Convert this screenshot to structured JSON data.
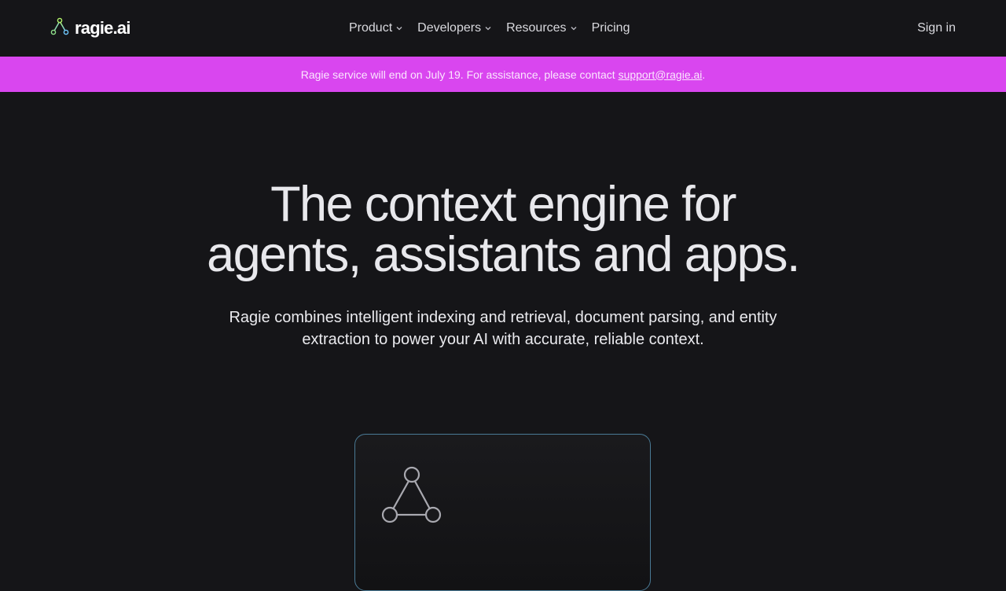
{
  "brand": {
    "name": "ragie.ai"
  },
  "nav": {
    "items": [
      {
        "label": "Product",
        "dropdown": true
      },
      {
        "label": "Developers",
        "dropdown": true
      },
      {
        "label": "Resources",
        "dropdown": true
      },
      {
        "label": "Pricing",
        "dropdown": false
      }
    ],
    "sign_in": "Sign in"
  },
  "banner": {
    "text": "Ragie service will end on July 19. For assistance, please contact ",
    "link": "support@ragie.ai",
    "suffix": "."
  },
  "hero": {
    "title_line1": "The context engine for",
    "title_line2": "agents, assistants and apps.",
    "subtitle_line1": "Ragie combines intelligent indexing and retrieval, document parsing, and entity",
    "subtitle_line2": "extraction to power your AI with accurate, reliable context."
  },
  "colors": {
    "background": "#151518",
    "banner": "#d946ef",
    "card_border": "#4a7a95"
  },
  "icons": {
    "logo": "triangle-nodes-icon",
    "dropdown": "chevron-down-icon",
    "card": "triangle-nodes-icon"
  }
}
